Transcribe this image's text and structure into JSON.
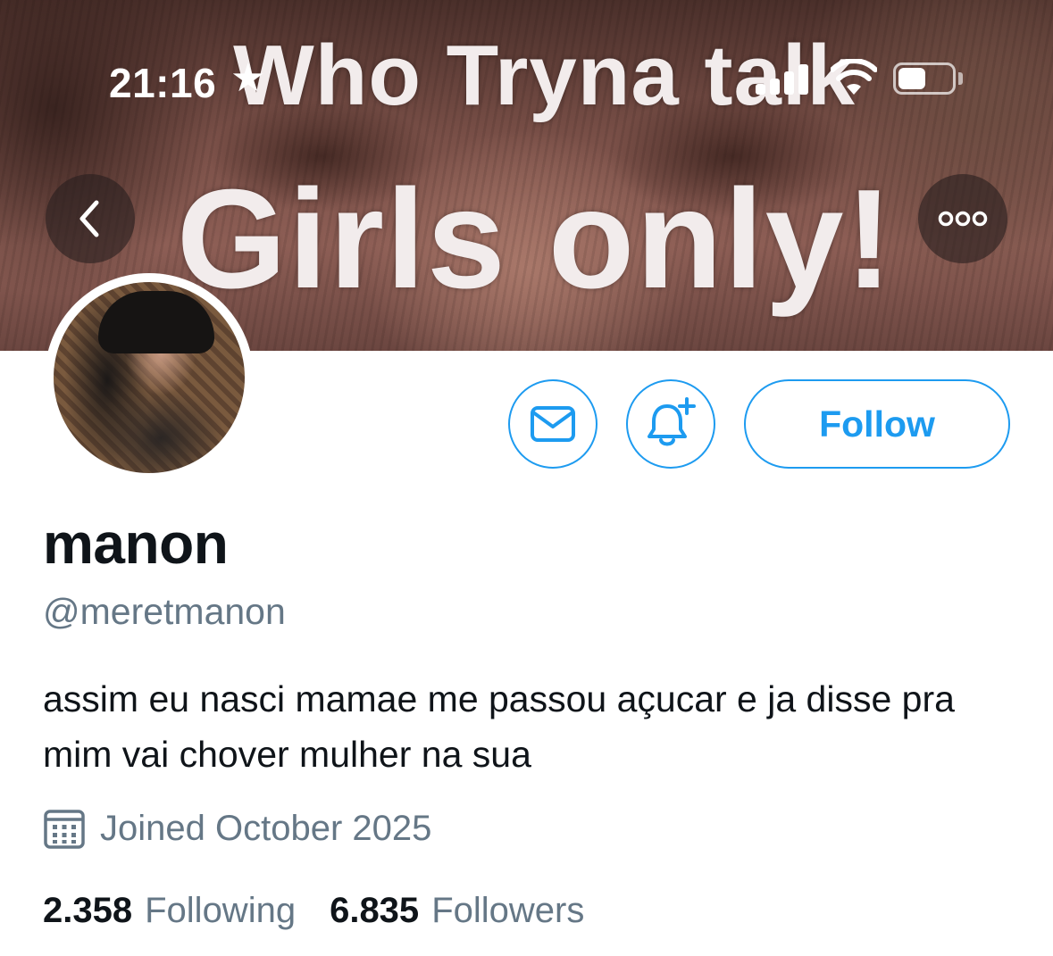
{
  "status_bar": {
    "time": "21:16",
    "star": "★"
  },
  "banner": {
    "line1": "Who Tryna talk",
    "line2": "Girls only!"
  },
  "profile": {
    "display_name": "manon",
    "handle": "@meretmanon",
    "bio": "assim eu nasci mamae me passou açucar e ja disse pra mim vai chover mulher na sua",
    "joined": "Joined October 2025"
  },
  "actions": {
    "follow_label": "Follow"
  },
  "stats": {
    "following_count": "2.358",
    "following_label": "Following",
    "followers_count": "6.835",
    "followers_label": "Followers"
  },
  "icons": {
    "back": "chevron-left-icon",
    "more": "more-horizontal-icon",
    "message": "envelope-icon",
    "notify": "bell-plus-icon",
    "calendar": "calendar-icon"
  },
  "colors": {
    "accent": "#1d9bf0",
    "secondary_text": "#657786",
    "primary_text": "#0f1419"
  }
}
